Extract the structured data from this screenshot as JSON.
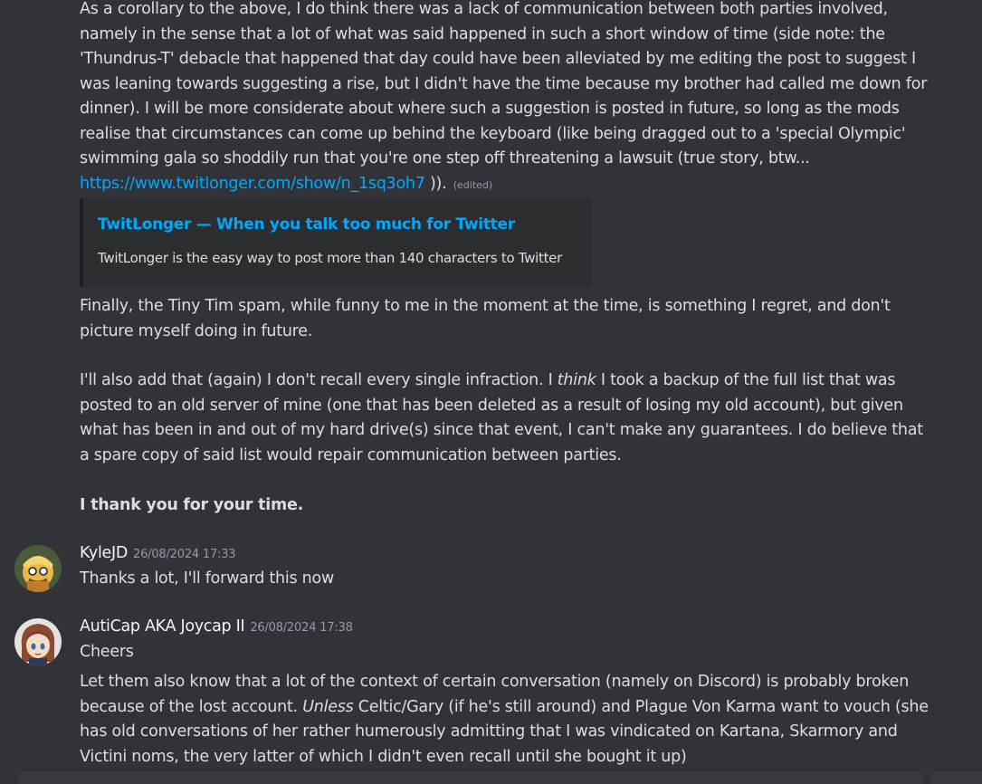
{
  "message1": {
    "para1": {
      "text": "As a corollary to the above, I do think there was a lack of communication between both parties involved, namely in the sense that a lot of what was said happened in such a short window of time (side note: the 'Thundrus-T' debacle that happened that day could have been alleviated by me editing the post to suggest I was leaning towards suggesting a rise, but I didn't have the time because my brother had called me down for dinner). I will be more considerate about where such a suggestion is posted in future, so long as the mods realise that circumstances can come up behind the keyboard (like being dragged out to a 'special Olympic' swimming gala so shoddily run that you're one step off threatening a lawsuit (true story, btw... ",
      "link": "https://www.twitlonger.com/show/n_1sq3oh7",
      "after_link": " )).",
      "edited": "(edited)"
    },
    "embed": {
      "title": "TwitLonger — When you talk too much for Twitter",
      "description": "TwitLonger is the easy way to post more than 140 characters to Twitter"
    },
    "para2": "Finally, the Tiny Tim spam, while funny to me in the moment at the time, is something I regret, and don't picture myself doing in future.",
    "para3": {
      "before": "I'll also add that (again) I don't recall every single infraction. I ",
      "italic": "think",
      "after": " I took a backup of the full list that was posted to an old server of mine (one that has been deleted as a result of losing my old account), but given what has been in and out of my hard drive(s) since that event, I can't make any guarantees. I do believe that a spare copy of said list would repair communication between parties."
    },
    "para4": "I thank you for your time."
  },
  "message2": {
    "username": "KyleJD",
    "timestamp": "26/08/2024 17:33",
    "text": "Thanks a lot, I'll forward this now",
    "avatar_icon": "avatar-kylejd"
  },
  "message3": {
    "username": "AutiCap AKA Joycap II",
    "timestamp": "26/08/2024 17:38",
    "line1": "Cheers",
    "para": {
      "before": "Let them also know that a lot of the context of certain conversation (namely on Discord) is probably broken because of the lost account. ",
      "italic": "Unless",
      "after": " Celtic/Gary (if he's still around) and Plague Von Karma want to vouch (she has old conversations of her rather humerously admitting that I was vindicated on Kartana, Skarmory and Victini noms, the very latter of which I didn't even recall until she bought it up)"
    },
    "avatar_icon": "avatar-auticap"
  },
  "colors": {
    "background": "#313338",
    "text": "#dbdee1",
    "link": "#00a8fc",
    "username": "#f2f3f5",
    "muted": "#949ba4",
    "embed_bg": "#2b2d31"
  }
}
